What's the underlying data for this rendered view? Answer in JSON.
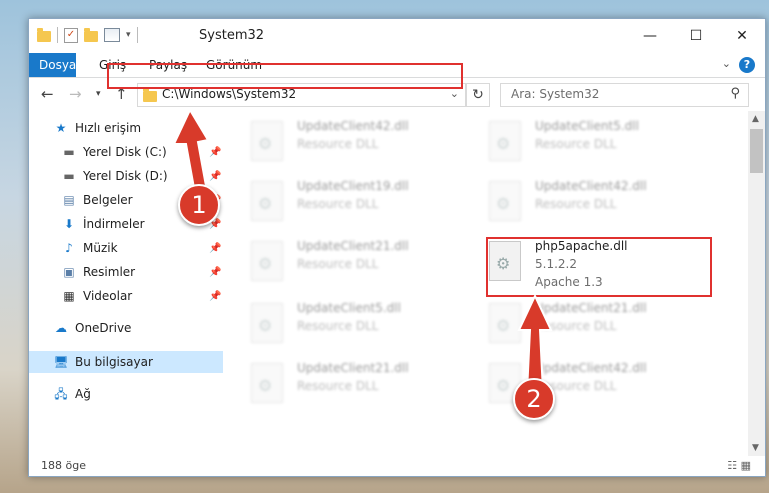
{
  "window": {
    "title": "System32",
    "buttons": [
      "—",
      "☐",
      "✕"
    ]
  },
  "ribbon": {
    "tabs": [
      "Dosya",
      "Giriş",
      "Paylaş",
      "Görünüm"
    ],
    "help": "?"
  },
  "address": {
    "path": "C:\\Windows\\System32",
    "search_placeholder": "Ara: System32"
  },
  "sidebar": {
    "items": [
      {
        "label": "Hızlı erişim",
        "icon": "star-icon",
        "pinned": false
      },
      {
        "label": "Yerel Disk (C:)",
        "icon": "drive-icon",
        "pinned": true
      },
      {
        "label": "Yerel Disk (D:)",
        "icon": "drive-icon",
        "pinned": true
      },
      {
        "label": "Belgeler",
        "icon": "documents-icon",
        "pinned": true
      },
      {
        "label": "İndirmeler",
        "icon": "download-icon",
        "pinned": true
      },
      {
        "label": "Müzik",
        "icon": "music-icon",
        "pinned": true
      },
      {
        "label": "Resimler",
        "icon": "pictures-icon",
        "pinned": true
      },
      {
        "label": "Videolar",
        "icon": "videos-icon",
        "pinned": true
      },
      {
        "label": "OneDrive",
        "icon": "cloud-icon",
        "pinned": false
      },
      {
        "label": "Bu bilgisayar",
        "icon": "computer-icon",
        "pinned": false,
        "selected": true
      },
      {
        "label": "Ağ",
        "icon": "network-icon",
        "pinned": false
      }
    ]
  },
  "files": [
    {
      "name": "UpdateClient42.dll",
      "desc": "Resource DLL"
    },
    {
      "name": "UpdateClient5.dll",
      "desc": "Resource DLL"
    },
    {
      "name": "UpdateClient19.dll",
      "desc": "Resource DLL"
    },
    {
      "name": "UpdateClient42.dll",
      "desc": "Resource DLL"
    },
    {
      "name": "UpdateClient21.dll",
      "desc": "Resource DLL"
    },
    {
      "name": "php5apache.dll",
      "version": "5.1.2.2",
      "desc": "Apache 1.3",
      "highlighted": true
    },
    {
      "name": "UpdateClient5.dll",
      "desc": "Resource DLL"
    },
    {
      "name": "UpdateClient21.dll",
      "desc": "Resource DLL"
    },
    {
      "name": "UpdateClient21.dll",
      "desc": "Resource DLL"
    },
    {
      "name": "UpdateClient42.dll",
      "desc": "Resource DLL"
    }
  ],
  "status": {
    "count": "188 öge"
  },
  "callouts": [
    "1",
    "2"
  ],
  "colors": {
    "accent": "#1979ca",
    "highlight": "#e0312f",
    "selection": "#cce8ff"
  }
}
